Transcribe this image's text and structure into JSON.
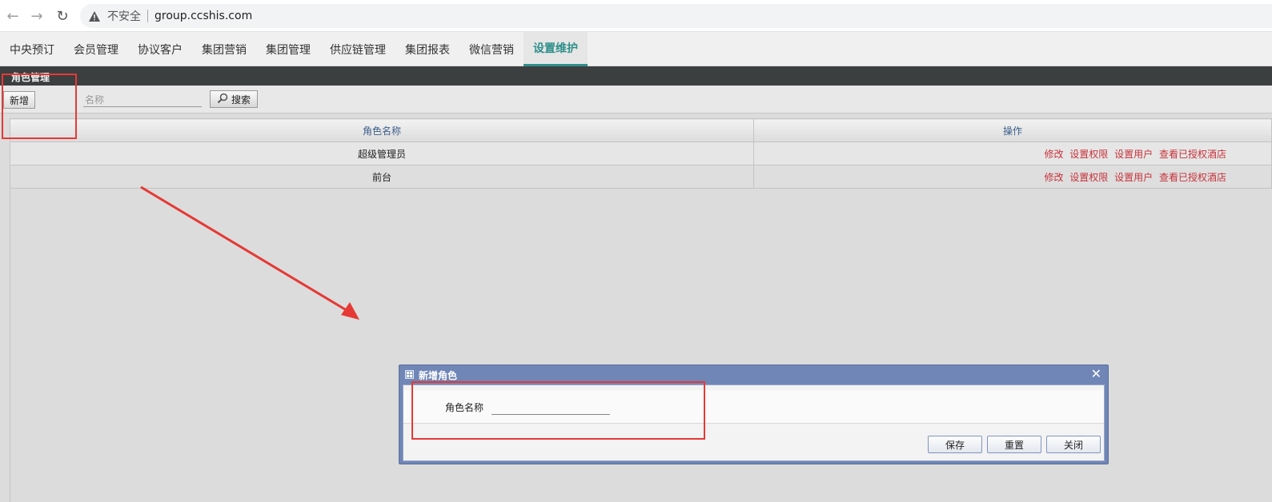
{
  "browser": {
    "security_label": "不安全",
    "url": "group.ccshis.com"
  },
  "nav": {
    "tabs": [
      {
        "label": "中央预订"
      },
      {
        "label": "会员管理"
      },
      {
        "label": "协议客户"
      },
      {
        "label": "集团营销"
      },
      {
        "label": "集团管理"
      },
      {
        "label": "供应链管理"
      },
      {
        "label": "集团报表"
      },
      {
        "label": "微信营销"
      },
      {
        "label": "设置维护",
        "active": true
      }
    ]
  },
  "module": {
    "title": "角色管理"
  },
  "toolbar": {
    "add_label": "新增",
    "name_placeholder": "名称",
    "search_label": "搜索"
  },
  "table": {
    "headers": {
      "name": "角色名称",
      "actions": "操作"
    },
    "rows": [
      {
        "name": "超级管理员"
      },
      {
        "name": "前台"
      }
    ],
    "actions": {
      "edit": "修改",
      "set_permissions": "设置权限",
      "set_users": "设置用户",
      "view_hotels": "查看已授权酒店"
    }
  },
  "dialog": {
    "title": "新增角色",
    "field_label": "角色名称",
    "field_value": "",
    "save_label": "保存",
    "reset_label": "重置",
    "close_label": "关闭"
  },
  "colors": {
    "accent": "#2f8f8a",
    "action_link": "#c8323a",
    "annotation": "#e53935",
    "dialog_frame": "#6f86b7"
  }
}
